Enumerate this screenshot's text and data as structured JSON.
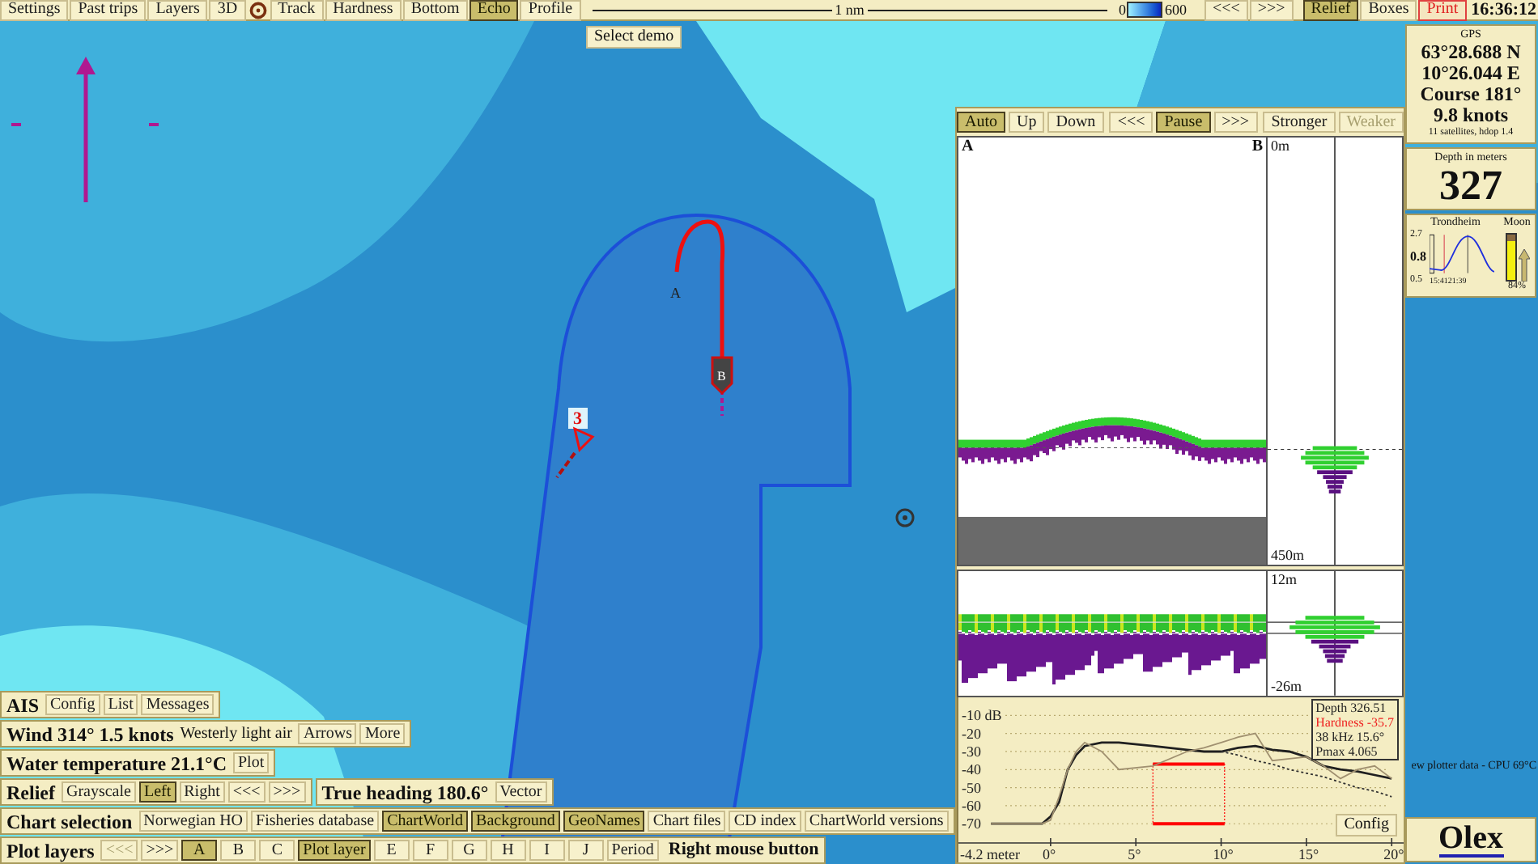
{
  "toolbar": {
    "items": [
      {
        "kind": "button",
        "label": "Settings",
        "selected": false
      },
      {
        "kind": "button",
        "label": "Past trips",
        "selected": false
      },
      {
        "kind": "button",
        "label": "Layers",
        "selected": false
      },
      {
        "kind": "button",
        "label": "3D",
        "selected": false
      },
      {
        "kind": "icon"
      },
      {
        "kind": "button",
        "label": "Track",
        "selected": false
      },
      {
        "kind": "button",
        "label": "Hardness",
        "selected": false
      },
      {
        "kind": "button",
        "label": "Bottom",
        "selected": false
      },
      {
        "kind": "button",
        "label": "Echo",
        "selected": true
      },
      {
        "kind": "button",
        "label": "Profile",
        "selected": false
      }
    ],
    "scale": "1 nm",
    "legend": {
      "min": "0",
      "max": "600"
    },
    "nav": [
      {
        "label": "<<<",
        "selected": false
      },
      {
        "label": ">>>",
        "selected": false
      }
    ],
    "right": [
      {
        "kind": "button",
        "label": "Relief",
        "selected": true
      },
      {
        "kind": "button",
        "label": "Boxes",
        "selected": false
      },
      {
        "kind": "warning",
        "label": "Print",
        "selected": false
      }
    ],
    "time": "16:36:12"
  },
  "map": {
    "demo_button": "Select demo",
    "track_start": "A",
    "track_end": "B",
    "waypoint": "3"
  },
  "control_rows": [
    {
      "groups": [
        {
          "title": "AIS",
          "buttons": [
            {
              "label": "Config",
              "selected": false
            },
            {
              "label": "List",
              "selected": false
            },
            {
              "label": "Messages",
              "selected": false
            }
          ]
        }
      ]
    },
    {
      "groups": [
        {
          "title": "Wind 314° 1.5 knots",
          "note": "Westerly light air",
          "buttons": [
            {
              "label": "Arrows",
              "selected": false
            },
            {
              "label": "More",
              "selected": false
            }
          ]
        }
      ]
    },
    {
      "groups": [
        {
          "title": "Water temperature 21.1°C",
          "buttons": [
            {
              "label": "Plot",
              "selected": false
            }
          ]
        }
      ]
    },
    {
      "groups": [
        {
          "title": "Relief",
          "buttons": [
            {
              "label": "Grayscale",
              "selected": false
            },
            {
              "label": "Left",
              "selected": true
            },
            {
              "label": "Right",
              "selected": false
            },
            {
              "label": "<<<",
              "selected": false
            },
            {
              "label": ">>>",
              "selected": false
            }
          ]
        },
        {
          "title": "True heading 180.6°",
          "buttons": [
            {
              "label": "Vector",
              "selected": false
            }
          ]
        }
      ]
    },
    {
      "groups": [
        {
          "title": "Chart selection",
          "buttons": [
            {
              "label": "Norwegian HO",
              "selected": false
            },
            {
              "label": "Fisheries database",
              "selected": false
            },
            {
              "label": "ChartWorld",
              "selected": true
            },
            {
              "label": "Background",
              "selected": true
            },
            {
              "label": "GeoNames",
              "selected": true
            },
            {
              "label": "Chart files",
              "selected": false
            },
            {
              "label": "CD index",
              "selected": false
            },
            {
              "label": "ChartWorld versions",
              "selected": false
            }
          ]
        }
      ]
    },
    {
      "groups": [
        {
          "title": "Plot layers",
          "buttons": [
            {
              "label": "<<<",
              "selected": false,
              "disabled": true
            },
            {
              "label": ">>>",
              "selected": false,
              "disabled": false
            },
            {
              "label": "A",
              "selected": true,
              "disabled": false
            },
            {
              "label": "B",
              "selected": false,
              "disabled": false
            },
            {
              "label": "C",
              "selected": false,
              "disabled": false
            },
            {
              "label": "Plot layer",
              "selected": true,
              "disabled": false
            },
            {
              "label": "E",
              "selected": false,
              "disabled": false
            },
            {
              "label": "F",
              "selected": false,
              "disabled": false
            },
            {
              "label": "G",
              "selected": false,
              "disabled": false
            },
            {
              "label": "H",
              "selected": false,
              "disabled": false
            },
            {
              "label": "I",
              "selected": false,
              "disabled": false
            },
            {
              "label": "J",
              "selected": false,
              "disabled": false
            },
            {
              "label": "Period",
              "selected": false,
              "disabled": false
            }
          ],
          "hint": "Right mouse button"
        }
      ]
    }
  ],
  "echo": {
    "toolbar_groups": [
      {
        "buttons": [
          {
            "label": "Auto",
            "selected": true,
            "disabled": false
          },
          {
            "label": "Up",
            "selected": false,
            "disabled": false
          },
          {
            "label": "Down",
            "selected": false,
            "disabled": false
          }
        ]
      },
      {
        "buttons": [
          {
            "label": "<<<",
            "selected": false,
            "disabled": false
          },
          {
            "label": "Pause",
            "selected": true,
            "disabled": false
          },
          {
            "label": ">>>",
            "selected": false,
            "disabled": false
          }
        ]
      },
      {
        "buttons": [
          {
            "label": "Stronger",
            "selected": false,
            "disabled": false
          },
          {
            "label": "Weaker",
            "selected": false,
            "disabled": true
          }
        ]
      }
    ],
    "echogram": {
      "left": "A",
      "right": "B",
      "top_depth": "0m",
      "bottom_depth": "450m"
    },
    "zoom_echogram": {
      "top_depth": "12m",
      "bottom_depth": "-26m"
    },
    "profile": {
      "info": [
        {
          "kind": "normal",
          "text": "Depth 326.51"
        },
        {
          "kind": "alert",
          "text": "Hardness -35.7"
        },
        {
          "kind": "normal",
          "text": "38 kHz 15.6°"
        },
        {
          "kind": "normal",
          "text": "Pmax 4.065"
        }
      ],
      "config_button": "Config",
      "axis_start_label": "-4.2 meter",
      "chart_data": {
        "type": "line",
        "xlim": [
          -5.5,
          20.7
        ],
        "ylim": [
          -91.4,
          0
        ],
        "grid": true,
        "x": [
          -3.5,
          -0.5,
          0,
          0.5,
          1,
          1.5,
          2,
          3,
          4,
          6,
          8,
          9,
          10,
          11,
          12,
          13,
          14,
          15,
          16,
          17,
          18,
          19,
          20
        ],
        "xticks": [
          {
            "value": 0,
            "label": "0°"
          },
          {
            "value": 5,
            "label": "5°"
          },
          {
            "value": 10,
            "label": "10°"
          },
          {
            "value": 15,
            "label": "15°"
          },
          {
            "value": 20,
            "label": "20°"
          }
        ],
        "yticks": [
          {
            "value": -10,
            "label": "-10 dB"
          },
          {
            "value": -20,
            "label": "-20"
          },
          {
            "value": -30,
            "label": "-30"
          },
          {
            "value": -40,
            "label": "-40"
          },
          {
            "value": -50,
            "label": "-50"
          },
          {
            "value": -60,
            "label": "-60"
          },
          {
            "value": -70,
            "label": "-70"
          }
        ],
        "series": [
          {
            "color": "#202020",
            "values": [
              -70,
              -70,
              -66,
              -58,
              -40,
              -32,
              -27,
              -25,
              -25,
              -27,
              -29,
              -30,
              -30,
              -28,
              -27,
              -29,
              -30,
              -33,
              -38,
              -40,
              -41,
              -43,
              -45
            ]
          },
          {
            "color": "#a09070",
            "values": [
              -70,
              -70,
              -68,
              -55,
              -40,
              -30,
              -25,
              -30,
              -40,
              -38,
              -30,
              -28,
              -25,
              -22,
              -20,
              -35,
              -34,
              -33,
              -38,
              -45,
              -40,
              -38,
              -45
            ]
          },
          {
            "color": "#303030",
            "line_style": "dashed",
            "values": [
              null,
              null,
              null,
              null,
              null,
              null,
              null,
              null,
              null,
              null,
              null,
              null,
              -30,
              -32,
              -35,
              -37,
              -40,
              -42,
              -44,
              -47,
              -50,
              -52,
              -55
            ]
          }
        ]
      }
    }
  },
  "gps": {
    "title": "GPS",
    "lat": "63°28.688 N",
    "lon": "10°26.044 E",
    "course": "Course 181°",
    "speed": "9.8 knots",
    "satellites": "11 satellites, hdop 1.4"
  },
  "depth": {
    "title": "Depth in meters",
    "value": "327"
  },
  "tide": {
    "place": "Trondheim",
    "max": "2.7",
    "current": "0.8",
    "min": "0.5",
    "time_1": "15:41",
    "time_2": "21:39"
  },
  "moon": {
    "label": "Moon",
    "level": 0.85,
    "reading": "84%"
  },
  "status": "ew plotter data - CPU 69°C",
  "logo": "Olex"
}
